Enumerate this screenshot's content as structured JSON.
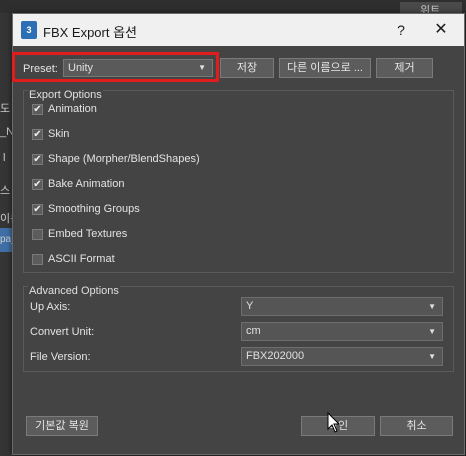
{
  "background": {
    "top_right": "위트",
    "fragments": [
      "도",
      "_N",
      "l",
      "스",
      "이름",
      "pa_"
    ]
  },
  "dialog": {
    "app_icon": "3",
    "title": "FBX Export 옵션",
    "help_label": "?",
    "close_label": "✕"
  },
  "preset": {
    "label": "Preset:",
    "value": "Unity",
    "save_label": "저장",
    "save_as_label": "다른 이름으로 ...",
    "delete_label": "제거"
  },
  "export_options": {
    "title": "Export Options",
    "items": [
      {
        "label": "Animation",
        "checked": true
      },
      {
        "label": "Skin",
        "checked": true
      },
      {
        "label": "Shape (Morpher/BlendShapes)",
        "checked": true
      },
      {
        "label": "Bake Animation",
        "checked": true
      },
      {
        "label": "Smoothing Groups",
        "checked": true
      },
      {
        "label": "Embed Textures",
        "checked": false
      },
      {
        "label": "ASCII Format",
        "checked": false
      }
    ]
  },
  "advanced_options": {
    "title": "Advanced Options",
    "up_axis": {
      "label": "Up Axis:",
      "value": "Y"
    },
    "convert_unit": {
      "label": "Convert Unit:",
      "value": "cm"
    },
    "file_version": {
      "label": "File Version:",
      "value": "FBX202000"
    }
  },
  "footer": {
    "reset_label": "기본값 복원",
    "ok_label": "확인",
    "cancel_label": "취소"
  },
  "colors": {
    "highlight": "#e01c1c",
    "dialog_bg": "#444444",
    "titlebar_bg": "#f0f0f0"
  }
}
